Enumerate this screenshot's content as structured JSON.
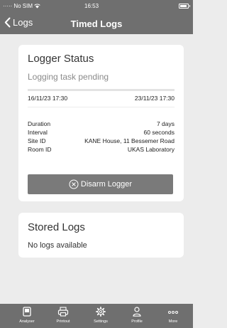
{
  "status_bar": {
    "carrier": "No SIM",
    "time": "16:53",
    "battery_level": 0.9
  },
  "nav": {
    "back_label": "Logs",
    "title": "Timed Logs"
  },
  "logger_status": {
    "title": "Logger Status",
    "state": "Logging task pending",
    "progress": 0,
    "start": "16/11/23 17:30",
    "end": "23/11/23 17:30",
    "details": [
      {
        "label": "Duration",
        "value": "7 days"
      },
      {
        "label": "Interval",
        "value": "60 seconds"
      },
      {
        "label": "Site ID",
        "value": "KANE House, 11 Bessemer Road"
      },
      {
        "label": "Room ID",
        "value": "UKAS Laboratory"
      }
    ],
    "disarm_label": "Disarm Logger"
  },
  "stored_logs": {
    "title": "Stored Logs",
    "empty_text": "No logs available"
  },
  "tab_bar": {
    "tabs": [
      {
        "label": "Analyser",
        "icon": "analyser-icon"
      },
      {
        "label": "Printout",
        "icon": "printer-icon"
      },
      {
        "label": "Settings",
        "icon": "gear-icon"
      },
      {
        "label": "Profile",
        "icon": "person-icon"
      },
      {
        "label": "More",
        "icon": "more-icon"
      }
    ]
  },
  "colors": {
    "bar": "#6f6f6f",
    "background": "#ececec",
    "card": "#ffffff",
    "button": "#7a7a7a"
  }
}
